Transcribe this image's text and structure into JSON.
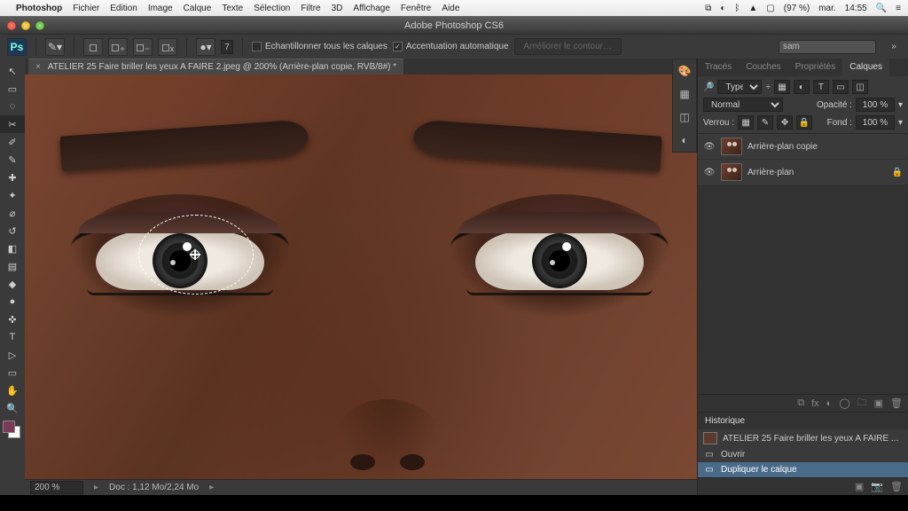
{
  "mac_menubar": {
    "app": "Photoshop",
    "items": [
      "Fichier",
      "Edition",
      "Image",
      "Calque",
      "Texte",
      "Sélection",
      "Filtre",
      "3D",
      "Affichage",
      "Fenêtre",
      "Aide"
    ],
    "right": {
      "battery": "(97 %)",
      "day": "mar.",
      "time": "14:55"
    }
  },
  "window": {
    "title": "Adobe Photoshop CS6"
  },
  "options_bar": {
    "brush_size": "7",
    "chk_sample_all_label": "Echantillonner tous les calques",
    "chk_auto_enhance_label": "Accentuation automatique",
    "refine_edge_label": "Améliorer le contour…",
    "search_value": "sam"
  },
  "document": {
    "tab_title": "ATELIER 25 Faire briller les yeux A FAIRE 2.jpeg @ 200% (Arrière-plan copie, RVB/8#) *"
  },
  "status": {
    "zoom": "200 %",
    "doc_info": "Doc : 1,12 Mo/2,24 Mo"
  },
  "panels": {
    "tabs": [
      "Tracés",
      "Couches",
      "Propriétés",
      "Calques"
    ],
    "type_filter_label": "Type",
    "blend_mode": "Normal",
    "opacity_label": "Opacité :",
    "opacity_value": "100 %",
    "lock_label": "Verrou :",
    "fill_label": "Fond :",
    "fill_value": "100 %",
    "layers": [
      {
        "name": "Arrière-plan copie",
        "locked": false
      },
      {
        "name": "Arrière-plan",
        "locked": true
      }
    ]
  },
  "history": {
    "panel_title": "Historique",
    "snapshot": "ATELIER 25 Faire briller les yeux A FAIRE ...",
    "items": [
      {
        "label": "Ouvrir",
        "selected": false
      },
      {
        "label": "Dupliquer le calque",
        "selected": true
      }
    ]
  },
  "tools": [
    "↖",
    "▭",
    "◌",
    "✂",
    "✎",
    "✐",
    "↺",
    "✜",
    "✦",
    "◆",
    "▤",
    "⌀",
    "●",
    "◧",
    "✚",
    "T",
    "▷",
    "▭",
    "✋",
    "🔍"
  ]
}
